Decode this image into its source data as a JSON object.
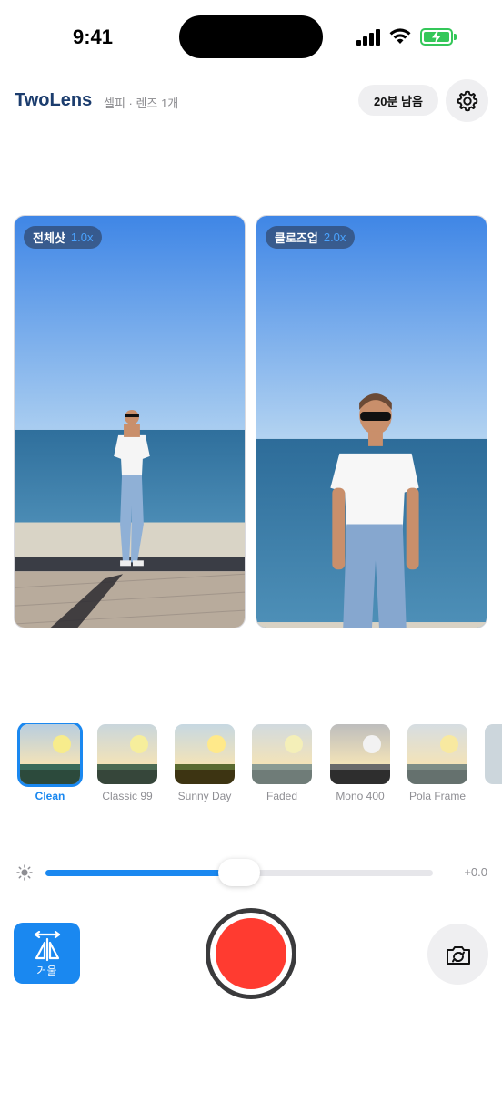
{
  "status_bar": {
    "time": "9:41"
  },
  "header": {
    "title": "TwoLens",
    "subtitle": "셀피 · 렌즈 1개",
    "time_remaining": "20분 남음",
    "settings_icon": "gear-icon"
  },
  "previews": [
    {
      "label": "전체샷",
      "zoom": "1.0x"
    },
    {
      "label": "클로즈업",
      "zoom": "2.0x"
    }
  ],
  "filters": [
    {
      "name": "Clean",
      "selected": true,
      "sky": "#b7cde0",
      "sun": "#f7ec8c",
      "band": "#3a6b5a",
      "ground": "#2c4a3c"
    },
    {
      "name": "Classic 99",
      "selected": false,
      "sky": "#c9d6dc",
      "sun": "#f6ee9c",
      "band": "#4c6a52",
      "ground": "#36463a"
    },
    {
      "name": "Sunny Day",
      "selected": false,
      "sky": "#c6d8e2",
      "sun": "#ffe98a",
      "band": "#5a6a30",
      "ground": "#3d3412"
    },
    {
      "name": "Faded",
      "selected": false,
      "sky": "#d1dadf",
      "sun": "#f4efb8",
      "band": "#8a9b93",
      "ground": "#6f7c78"
    },
    {
      "name": "Mono 400",
      "selected": false,
      "sky": "#bdbdbd",
      "sun": "#f2f2f2",
      "band": "#6a6a6a",
      "ground": "#2e2e2e"
    },
    {
      "name": "Pola Frame",
      "selected": false,
      "sky": "#d6dde2",
      "sun": "#f8e9a0",
      "band": "#7d8d86",
      "ground": "#65716e"
    }
  ],
  "exposure": {
    "value_label": "+0.0",
    "level": 0.5
  },
  "controls": {
    "mirror_label": "거울",
    "mirror_icon": "mirror-flip-icon",
    "record_icon": "record-icon",
    "flip_camera_icon": "camera-flip-icon"
  },
  "colors": {
    "accent": "#1a88f0",
    "record": "#ff3b30",
    "title": "#1c3d6e"
  }
}
